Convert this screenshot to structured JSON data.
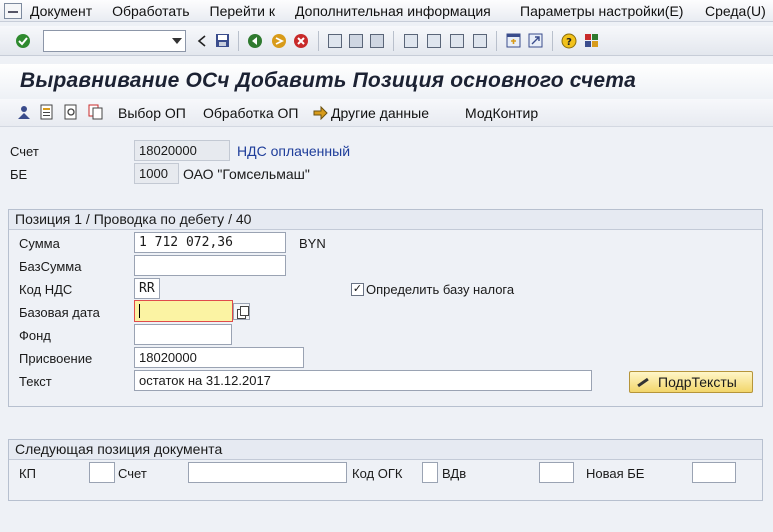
{
  "menu": {
    "items": [
      "Документ",
      "Обработать",
      "Перейти к",
      "Дополнительная информация"
    ],
    "right_items": [
      "Параметры настройки(E)",
      "Среда(U)"
    ]
  },
  "system_toolbar": {
    "command_field_value": "",
    "icons": [
      "enter-icon",
      "back-icon",
      "save-icon",
      "exit-icon",
      "cancel-icon",
      "print-icon",
      "find-icon",
      "find-next-icon",
      "first-page-icon",
      "prev-page-icon",
      "next-page-icon",
      "last-page-icon",
      "new-session-icon",
      "shortcut-icon",
      "help-icon",
      "customize-layout-icon"
    ]
  },
  "title": "Выравнивание ОСч Добавить Позиция основного счета",
  "app_toolbar": {
    "icons": [
      "person-icon",
      "document-overview-icon",
      "document-display-icon",
      "copy-icon"
    ],
    "buttons": [
      "Выбор ОП",
      "Обработка ОП",
      "Другие данные",
      "МодКонтир"
    ]
  },
  "header": {
    "account_label": "Счет",
    "account_value": "18020000",
    "account_desc": "НДС оплаченный",
    "company_label": "БЕ",
    "company_value": "1000",
    "company_desc": "ОАО \"Гомсельмаш\""
  },
  "position_group": {
    "title": "Позиция 1 / Проводка по дебету / 40",
    "fields": {
      "amount_label": "Сумма",
      "amount_value": "1 712 072,36",
      "currency": "BYN",
      "base_amount_label": "БазСумма",
      "base_amount_value": "",
      "tax_code_label": "Код НДС",
      "tax_code_value": "RR",
      "calc_tax_label": "Определить базу налога",
      "calc_tax_checked": "✓",
      "baseline_date_label": "Базовая дата",
      "baseline_date_value": "",
      "fund_label": "Фонд",
      "fund_value": "",
      "assignment_label": "Присвоение",
      "assignment_value": "18020000",
      "text_label": "Текст",
      "text_value": "остаток на 31.12.2017",
      "long_texts_button": "ПодрТексты"
    }
  },
  "next_group": {
    "title": "Следующая позиция документа",
    "posting_key_label": "КП",
    "posting_key_value": "",
    "account_label": "Счет",
    "account_value": "",
    "sgl_label": "Код ОГК",
    "sgl_value": "",
    "trans_type_label": "ВДв",
    "trans_type_value": "",
    "new_company_label": "Новая БЕ",
    "new_company_value": ""
  },
  "colors": {
    "focus_field": "#fbf3a3",
    "link_blue": "#1e3d9a",
    "button_yellow": "#f2d66b"
  }
}
